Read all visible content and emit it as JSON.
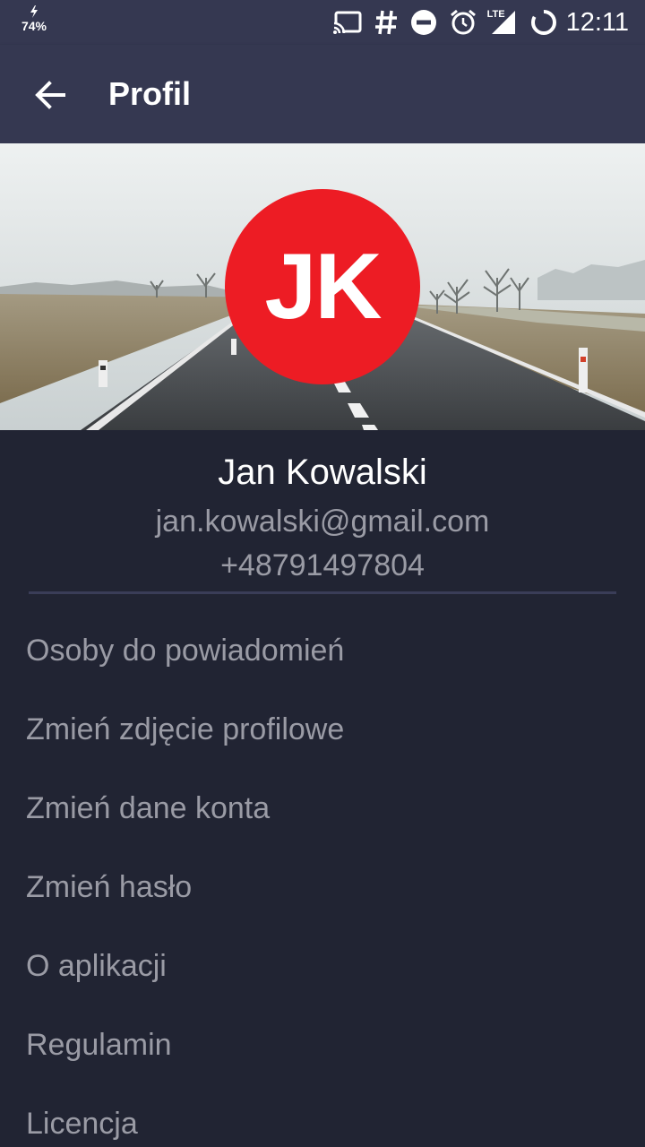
{
  "status_bar": {
    "battery_percent": "74%",
    "network": "LTE",
    "time": "12:11",
    "icons": [
      "charging-icon",
      "cast-icon",
      "hash-icon",
      "do-not-disturb-icon",
      "alarm-icon",
      "lte-signal-icon",
      "battery-ring-icon"
    ]
  },
  "app_bar": {
    "title": "Profil",
    "back_icon": "arrow-back-icon"
  },
  "profile": {
    "initials": "JK",
    "avatar_color": "#ed1c24",
    "name": "Jan Kowalski",
    "email": "jan.kowalski@gmail.com",
    "phone": "+48791497804"
  },
  "menu": {
    "items": [
      {
        "label": "Osoby do powiadomień"
      },
      {
        "label": "Zmień zdjęcie profilowe"
      },
      {
        "label": "Zmień dane konta"
      },
      {
        "label": "Zmień hasło"
      },
      {
        "label": "O aplikacji"
      },
      {
        "label": "Regulamin"
      },
      {
        "label": "Licencja"
      }
    ]
  },
  "colors": {
    "app_bar": "#353851",
    "background": "#212433",
    "text_primary": "#ffffff",
    "text_secondary": "#9a9ba5",
    "divider": "#3a3d58"
  }
}
